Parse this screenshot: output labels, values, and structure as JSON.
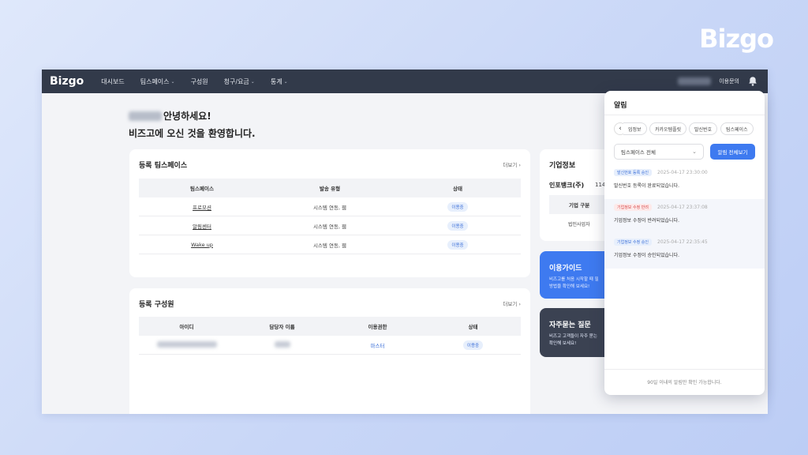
{
  "brand_corner": "Bizgo",
  "nav": {
    "logo": "Bizgo",
    "items": [
      {
        "label": "대시보드"
      },
      {
        "label": "팀스페이스",
        "chevron": "chevron-down-icon"
      },
      {
        "label": "구성원"
      },
      {
        "label": "청구/요금",
        "chevron": "chevron-down-icon"
      },
      {
        "label": "통계",
        "chevron": "chevron-down-icon"
      }
    ],
    "inquiry": "이용문의"
  },
  "greeting": {
    "line1": "안녕하세요!",
    "line2": "비즈고에 오신 것을 환영합니다."
  },
  "teamspace_card": {
    "title": "등록 팀스페이스",
    "more": "더보기",
    "columns": [
      "팀스페이스",
      "발송 유형",
      "상태"
    ],
    "rows": [
      {
        "name": "프로모션",
        "type": "시스템 연동, 웹",
        "status": "이용중"
      },
      {
        "name": "알림센터",
        "type": "시스템 연동, 웹",
        "status": "이용중"
      },
      {
        "name": "Wake up",
        "type": "시스템 연동, 웹",
        "status": "이용중"
      }
    ]
  },
  "member_card": {
    "title": "등록 구성원",
    "more": "더보기",
    "columns": [
      "아이디",
      "담당자 이름",
      "이용권한",
      "상태"
    ],
    "rows": [
      {
        "role": "마스터",
        "status": "이용중"
      }
    ]
  },
  "company_card": {
    "title": "기업정보",
    "company_name": "인포뱅크(주)",
    "partial_number": "114-",
    "column": "기업 구분",
    "value": "법인사업자"
  },
  "guide_card": {
    "title": "이용가이드",
    "desc_line1": "비즈고를 처음 시작할 때 필",
    "desc_line2": "방법을 확인해 보세요!"
  },
  "faq_card": {
    "title": "자주묻는 질문",
    "desc_line1": "비즈고 고객들이 자주 묻는",
    "desc_line2": "확인해 보세요!"
  },
  "notifications": {
    "title": "알림",
    "chips": [
      "업정보",
      "카카오템플릿",
      "발신번호",
      "팀스페이스"
    ],
    "workspace_select": "팀스페이스 전체",
    "view_all": "알림 전체보기",
    "items": [
      {
        "tag": "발신번호 등록 승인",
        "tag_color": "#3b6fd8",
        "time": "2025-04-17 23:30:00",
        "message": "발신번호 등록이 완료되었습니다."
      },
      {
        "tag": "기업정보 수정 반려",
        "tag_color": "#d94848",
        "time": "2025-04-17 23:37:08",
        "message": "기업정보 수정이 반려되었습니다."
      },
      {
        "tag": "기업정보 수정 승인",
        "tag_color": "#3b6fd8",
        "time": "2025-04-17 22:35:45",
        "message": "기업정보 수정이 승인되었습니다."
      }
    ],
    "footer": "90일 이내의 알림만 확인 가능합니다."
  }
}
